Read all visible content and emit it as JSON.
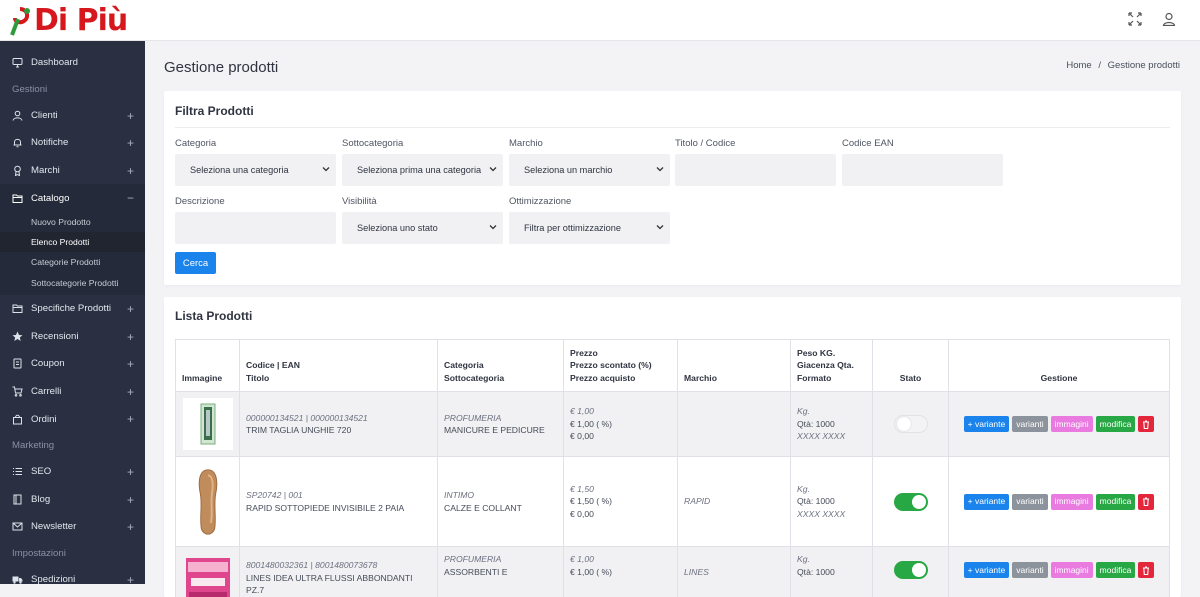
{
  "brand": {
    "logo_text": "Di Più"
  },
  "topbar": {
    "icons": [
      "fullscreen-icon",
      "user-icon"
    ]
  },
  "sidebar": {
    "dashboard": "Dashboard",
    "section_gestioni": "Gestioni",
    "clienti": "Clienti",
    "notifiche": "Notifiche",
    "marchi": "Marchi",
    "catalogo": "Catalogo",
    "catalogo_sub": [
      "Nuovo Prodotto",
      "Elenco Prodotti",
      "Categorie Prodotti",
      "Sottocategorie Prodotti"
    ],
    "specifiche": "Specifiche Prodotti",
    "recensioni": "Recensioni",
    "coupon": "Coupon",
    "carrelli": "Carrelli",
    "ordini": "Ordini",
    "section_marketing": "Marketing",
    "seo": "SEO",
    "blog": "Blog",
    "newsletter": "Newsletter",
    "section_impostazioni": "Impostazioni",
    "spedizioni": "Spedizioni",
    "plus": "+",
    "minus": "−"
  },
  "page": {
    "title": "Gestione prodotti",
    "breadcrumb_home": "Home",
    "breadcrumb_sep": "/",
    "breadcrumb_current": "Gestione prodotti"
  },
  "filter": {
    "title": "Filtra Prodotti",
    "categoria_label": "Categoria",
    "categoria_value": "Seleziona una categoria",
    "sottocategoria_label": "Sottocategoria",
    "sottocategoria_value": "Seleziona prima una categoria",
    "marchio_label": "Marchio",
    "marchio_value": "Seleziona un marchio",
    "titolo_label": "Titolo / Codice",
    "ean_label": "Codice EAN",
    "descrizione_label": "Descrizione",
    "visibilita_label": "Visibilità",
    "visibilita_value": "Seleziona uno stato",
    "ottimizzazione_label": "Ottimizzazione",
    "ottimizzazione_value": "Filtra per ottimizzazione",
    "search_button": "Cerca"
  },
  "list": {
    "title": "Lista Prodotti",
    "headers": {
      "immagine": "Immagine",
      "codice": "Codice | EAN",
      "titolo": "Titolo",
      "categoria": "Categoria",
      "sottocategoria": "Sottocategoria",
      "prezzo": "Prezzo",
      "prezzo_scontato": "Prezzo scontato (%)",
      "prezzo_acquisto": "Prezzo acquisto",
      "marchio": "Marchio",
      "peso": "Peso KG.",
      "giacenza": "Giacenza Qta.",
      "formato": "Formato",
      "stato": "Stato",
      "gestione": "Gestione"
    },
    "actions": {
      "add_variant": "+ variante",
      "variants": "varianti",
      "images": "immagini",
      "edit": "modifica"
    },
    "rows": [
      {
        "codice": "000000134521 | 000000134521",
        "titolo": "TRIM TAGLIA UNGHIE 720",
        "categoria": "PROFUMERIA",
        "sottocategoria": "MANICURE E PEDICURE",
        "prezzo": "€ 1,00",
        "prezzo_scontato": "€ 1,00 ( %)",
        "prezzo_acquisto": "€ 0,00",
        "marchio": "",
        "peso": "Kg.",
        "qta": "Qtà: 1000",
        "formato": "XXXX XXXX",
        "stato": false
      },
      {
        "codice": "SP20742 | 001",
        "titolo": "RAPID SOTTOPIEDE INVISIBILE 2 PAIA",
        "categoria": "INTIMO",
        "sottocategoria": "CALZE E COLLANT",
        "prezzo": "€ 1,50",
        "prezzo_scontato": "€ 1,50 ( %)",
        "prezzo_acquisto": "€ 0,00",
        "marchio": "RAPID",
        "peso": "Kg.",
        "qta": "Qtà: 1000",
        "formato": "XXXX XXXX",
        "stato": true
      },
      {
        "codice": "8001480032361 | 8001480073678",
        "titolo": "LINES IDEA ULTRA FLUSSI ABBONDANTI PZ.7",
        "categoria": "PROFUMERIA",
        "sottocategoria": "ASSORBENTI E",
        "prezzo": "€ 1,00",
        "prezzo_scontato": "€ 1,00 ( %)",
        "prezzo_acquisto": "",
        "marchio": "LINES",
        "peso": "Kg.",
        "qta": "Qtà: 1000",
        "formato": "",
        "stato": true
      }
    ]
  },
  "colors": {
    "brand_red": "#d6181e",
    "sidebar_bg": "#2a3042",
    "primary": "#1a84ec",
    "success": "#28a745",
    "pink": "#e87ae0",
    "danger": "#e3263b"
  }
}
